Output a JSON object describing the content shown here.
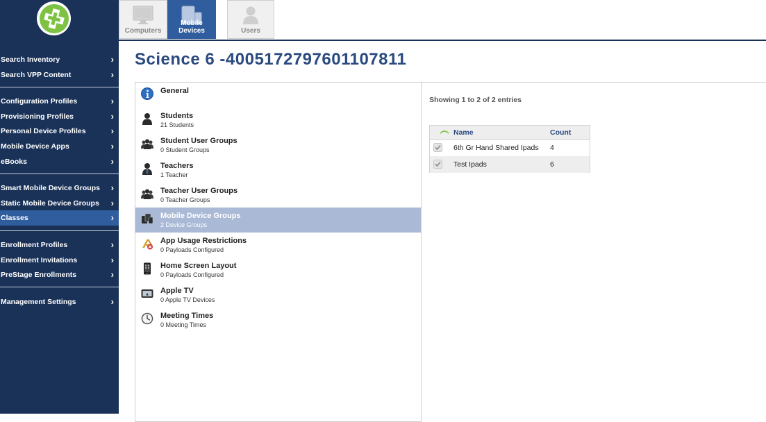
{
  "sidebar": {
    "items": [
      {
        "label": "Search Inventory"
      },
      {
        "label": "Search VPP Content"
      },
      {
        "label": "Configuration Profiles"
      },
      {
        "label": "Provisioning Profiles"
      },
      {
        "label": "Personal Device Profiles"
      },
      {
        "label": "Mobile Device Apps"
      },
      {
        "label": "eBooks"
      },
      {
        "label": "Smart Mobile Device Groups"
      },
      {
        "label": "Static Mobile Device Groups"
      },
      {
        "label": "Classes"
      },
      {
        "label": "Enrollment Profiles"
      },
      {
        "label": "Enrollment Invitations"
      },
      {
        "label": "PreStage Enrollments"
      },
      {
        "label": "Management Settings"
      }
    ],
    "chevron": "›",
    "active_item": "Classes"
  },
  "tabs": [
    {
      "label": "Computers",
      "icon": "monitor-icon"
    },
    {
      "label": "Mobile Devices",
      "icon": "mobile-devices-icon"
    },
    {
      "label": "Users",
      "icon": "user-icon"
    }
  ],
  "active_tab": "Mobile Devices",
  "page": {
    "title": "Science 6 -4005172797601107811"
  },
  "list": {
    "items": [
      {
        "title": "General",
        "subtitle": "",
        "icon": "info-icon"
      },
      {
        "title": "Students",
        "subtitle": "21 Students",
        "icon": "student-icon"
      },
      {
        "title": "Student User Groups",
        "subtitle": "0 Student Groups",
        "icon": "user-group-icon"
      },
      {
        "title": "Teachers",
        "subtitle": "1 Teacher",
        "icon": "teacher-icon"
      },
      {
        "title": "Teacher User Groups",
        "subtitle": "0 Teacher Groups",
        "icon": "user-group-icon"
      },
      {
        "title": "Mobile Device Groups",
        "subtitle": "2 Device Groups",
        "icon": "device-group-icon"
      },
      {
        "title": "App Usage Restrictions",
        "subtitle": "0 Payloads Configured",
        "icon": "app-restriction-icon"
      },
      {
        "title": "Home Screen Layout",
        "subtitle": "0 Payloads Configured",
        "icon": "home-screen-icon"
      },
      {
        "title": "Apple TV",
        "subtitle": "0 Apple TV Devices",
        "icon": "apple-tv-icon"
      },
      {
        "title": "Meeting Times",
        "subtitle": "0 Meeting Times",
        "icon": "clock-icon"
      }
    ],
    "active_item": "Mobile Device Groups"
  },
  "detail": {
    "showing": "Showing 1 to 2 of 2 entries",
    "columns": {
      "name": "Name",
      "count": "Count"
    },
    "rows": [
      {
        "name": "6th Gr Hand Shared Ipads",
        "count": "4"
      },
      {
        "name": "Test Ipads",
        "count": "6"
      }
    ]
  },
  "colors": {
    "sidebar_bg": "#1a3258",
    "accent": "#2f5d9d",
    "title": "#2a4a80",
    "logo_green": "#7dc242"
  }
}
